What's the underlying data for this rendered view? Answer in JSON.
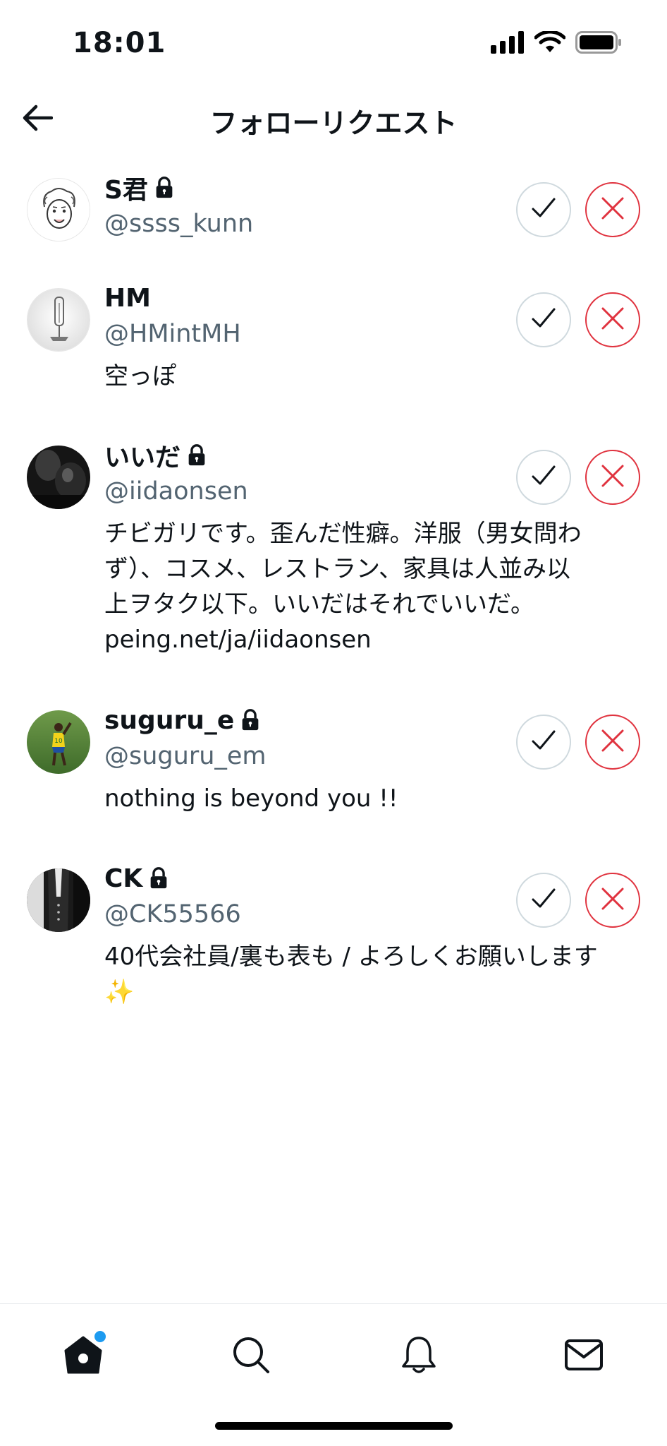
{
  "status_bar": {
    "time": "18:01",
    "icons": [
      "signal-icon",
      "wifi-icon",
      "battery-icon"
    ]
  },
  "header": {
    "title": "フォローリクエスト",
    "back_icon": "arrow-left-icon"
  },
  "requests": [
    {
      "display_name": "S君",
      "protected": true,
      "handle": "@ssss_kunn",
      "bio": "",
      "avatar": "sketch-face"
    },
    {
      "display_name": "HM",
      "protected": false,
      "handle": "@HMintMH",
      "bio": "空っぽ",
      "avatar": "grey-object"
    },
    {
      "display_name": "いいだ",
      "protected": true,
      "handle": "@iidaonsen",
      "bio": "チビガリです。歪んだ性癖。洋服（男女問わ\nず）、コスメ、レストラン、家具は人並み以\n上ヲタク以下。いいだはそれでいいだ。\npeing.net/ja/iidaonsen",
      "avatar": "dark-photo"
    },
    {
      "display_name": "suguru_e",
      "protected": true,
      "handle": "@suguru_em",
      "bio": "nothing is beyond you !!",
      "avatar": "soccer-player"
    },
    {
      "display_name": "CK",
      "protected": true,
      "handle": "@CK55566",
      "bio": "40代会社員/裏も表も / よろしくお願いします\n✨",
      "avatar": "suit-photo"
    }
  ],
  "tab_bar": {
    "tabs": [
      "home-icon",
      "search-icon",
      "bell-icon",
      "mail-icon"
    ],
    "home_has_notification": true
  },
  "colors": {
    "reject": "#e0333f",
    "accept_border": "#cfd9de",
    "handle_gray": "#536471",
    "notification_blue": "#1d9bf0"
  }
}
